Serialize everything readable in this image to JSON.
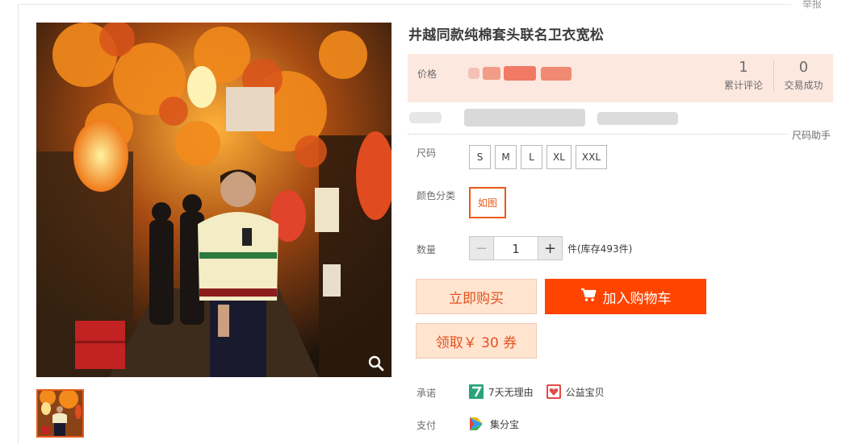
{
  "report_link": "举报",
  "product": {
    "title": "井越同款纯棉套头联名卫衣宽松"
  },
  "price_panel": {
    "price_label": "价格",
    "reviews_count": "1",
    "reviews_label": "累计评论",
    "sales_count": "0",
    "sales_label": "交易成功"
  },
  "size_helper": "尺码助手",
  "size": {
    "label": "尺码",
    "options": [
      "S",
      "M",
      "L",
      "XL",
      "XXL"
    ]
  },
  "color": {
    "label": "颜色分类",
    "selected": "如图"
  },
  "quantity": {
    "label": "数量",
    "minus": "−",
    "value": "1",
    "plus": "+",
    "stock_text": "件(库存493件)"
  },
  "buttons": {
    "buy_now": "立即购买",
    "add_to_cart": "加入购物车",
    "coupon": "领取￥ 30 券"
  },
  "promises": {
    "label": "承诺",
    "items": [
      "7天无理由",
      "公益宝贝"
    ]
  },
  "payment": {
    "label": "支付",
    "method": "集分宝"
  },
  "colors": {
    "accent": "#ff4400",
    "accent_light": "#ffe4d0",
    "price_bg": "#fde8e0"
  }
}
